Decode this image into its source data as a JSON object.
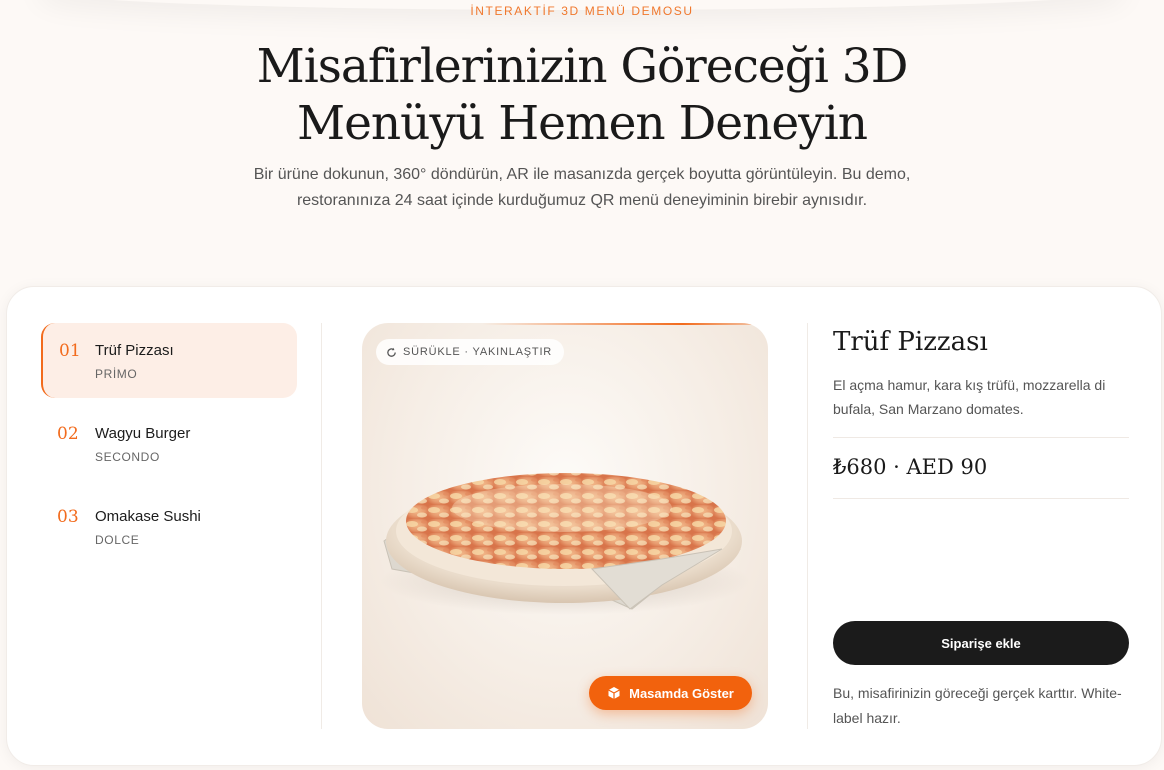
{
  "hero": {
    "eyebrow": "İNTERAKTİF 3D MENÜ DEMOSU",
    "title_line1": "Misafirlerinizin Göreceği 3D",
    "title_line2": "Menüyü Hemen Deneyin",
    "subtitle_line1": "Bir ürüne dokunun, 360° döndürün, AR ile masanızda gerçek boyutta görüntüleyin. Bu demo,",
    "subtitle_line2": "restoranınıza 24 saat içinde kurduğumuz QR menü deneyiminin birebir aynısıdır."
  },
  "menu": {
    "items": [
      {
        "num": "01",
        "name": "Trüf Pizzası",
        "category": "PRİMO",
        "active": true
      },
      {
        "num": "02",
        "name": "Wagyu Burger",
        "category": "SECONDO",
        "active": false
      },
      {
        "num": "03",
        "name": "Omakase Sushi",
        "category": "DOLCE",
        "active": false
      }
    ]
  },
  "viewer": {
    "hint_icon": "rotate-icon",
    "hint": "SÜRÜKLE · YAKINLAŞTIR",
    "ar_icon": "cube-icon",
    "ar_label": "Masamda Göster",
    "accent_color": "#f2620d"
  },
  "detail": {
    "title": "Trüf Pizzası",
    "description": "El açma hamur, kara kış trüfü, mozzarella di bufala, San Marzano domates.",
    "price": "₺680 · AED 90",
    "order_label": "Siparişe ekle",
    "note": "Bu, misafirinizin göreceği gerçek karttır. White-label hazır."
  },
  "colors": {
    "accent": "#f26b1d",
    "dark_button": "#1b1b1b",
    "background": "#fdf9f6"
  }
}
